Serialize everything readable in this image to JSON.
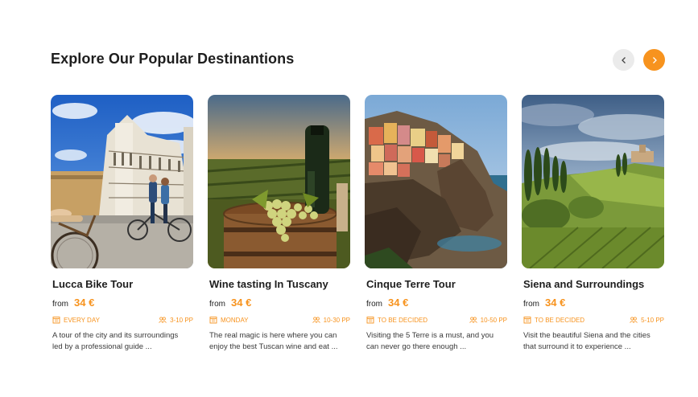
{
  "section": {
    "title": "Explore Our Popular Destinantions",
    "prev_icon": "chevron-left-icon",
    "next_icon": "chevron-right-icon"
  },
  "colors": {
    "accent": "#f7931e",
    "prev_button_bg": "#ebebeb",
    "text": "#1e1e1e"
  },
  "cards": [
    {
      "title": "Lucca Bike Tour",
      "image": "lucca-church-cyclists-photo",
      "from": "from",
      "price": "34 €",
      "schedule": "EVERY DAY",
      "group": "3-10 PP",
      "description_line1": "A tour of the city and its surroundings",
      "description_line2": "led by a professional guide ..."
    },
    {
      "title": "Wine tasting In Tuscany",
      "image": "wine-bottle-grapes-barrel-photo",
      "from": "from",
      "price": "34 €",
      "schedule": "MONDAY",
      "group": "10-30 PP",
      "description_line1": "The real magic is here where you can",
      "description_line2": "enjoy the best Tuscan wine and eat ..."
    },
    {
      "title": "Cinque Terre Tour",
      "image": "cinque-terre-coastal-village-photo",
      "from": "from",
      "price": "34 €",
      "schedule": "TO BE DECIDED",
      "group": "10-50 PP",
      "description_line1": "Visiting the 5 Terre is a must, and you",
      "description_line2": "can never go there enough ..."
    },
    {
      "title": "Siena and Surroundings",
      "image": "siena-countryside-cypress-photo",
      "from": "from",
      "price": "34 €",
      "schedule": "TO BE DECIDED",
      "group": "5-10 PP",
      "description_line1": "Visit the beautiful Siena and the cities",
      "description_line2": "that surround it to experience ..."
    }
  ]
}
